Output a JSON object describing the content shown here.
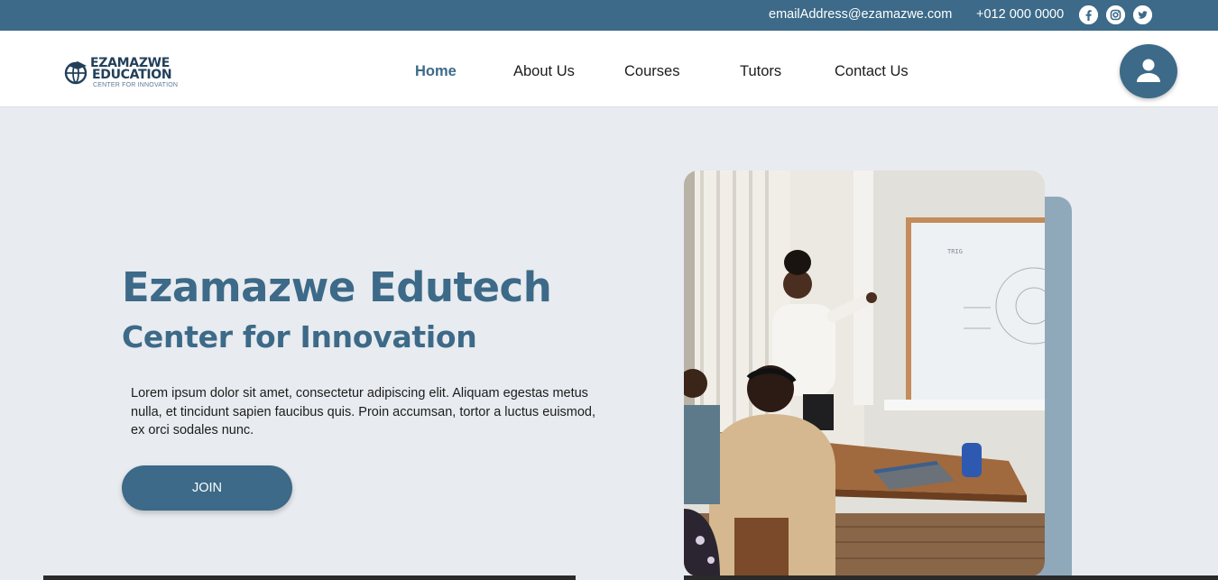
{
  "topbar": {
    "email": "emailAddress@ezamazwe.com",
    "phone": "+012 000 0000",
    "social": [
      "facebook-icon",
      "instagram-icon",
      "twitter-icon"
    ]
  },
  "logo": {
    "line1": "EZAMAZWE",
    "line2": "EDUCATION",
    "line3": "CENTER FOR INNOVATION"
  },
  "nav": {
    "home": "Home",
    "about": "About Us",
    "courses": "Courses",
    "tutors": "Tutors",
    "contact": "Contact Us",
    "active": "Home"
  },
  "hero": {
    "title": "Ezamazwe Edutech",
    "subtitle": "Center for Innovation",
    "text": "Lorem ipsum dolor sit amet, consectetur adipiscing elit. Aliquam egestas metus nulla, et tincidunt sapien faucibus quis. Proin accumsan, tortor a luctus euismod, ex orci sodales nunc.",
    "join_label": "JOIN"
  },
  "colors": {
    "primary": "#3c6a88",
    "background": "#e8ebef",
    "accent_block": "#90a9ba"
  }
}
